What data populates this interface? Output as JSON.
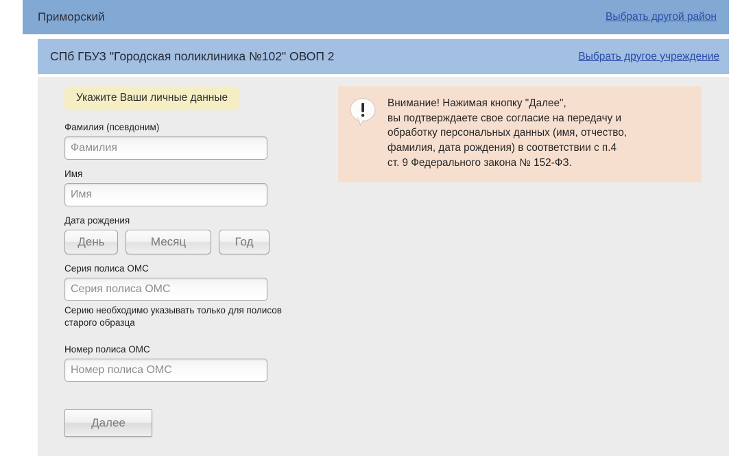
{
  "district_bar": {
    "district_name": "Приморский",
    "change_district_link": "Выбрать другой район"
  },
  "institution_bar": {
    "institution_name": "СПб ГБУЗ \"Городская поликлиника №102\" ОВОП 2",
    "change_institution_link": "Выбрать другое учреждение"
  },
  "form": {
    "section_badge": "Укажите Ваши личные данные",
    "fields": {
      "last_name": {
        "label": "Фамилия (псевдоним)",
        "placeholder": "Фамилия",
        "value": ""
      },
      "first_name": {
        "label": "Имя",
        "placeholder": "Имя",
        "value": ""
      },
      "birth_date": {
        "label": "Дата рождения",
        "day": "День",
        "month": "Месяц",
        "year": "Год"
      },
      "policy_series": {
        "label": "Серия полиса ОМС",
        "placeholder": "Серия полиса ОМС",
        "value": "",
        "hint": "Серию необходимо указывать только для полисов старого образца"
      },
      "policy_number": {
        "label": "Номер полиса ОМС",
        "placeholder": "Номер полиса ОМС",
        "value": ""
      }
    },
    "submit_label": "Далее"
  },
  "notice": {
    "icon": "exclamation-bubble-icon",
    "text": "Внимание! Нажимая кнопку \"Далее\",\nвы подтверждаете свое согласие на передачу и\nобработку персональных данных (имя, отчество,\nфамилия, дата рождения) в соответствии с п.4\nст. 9 Федерального закона № 152-ФЗ."
  },
  "colors": {
    "district_bar_bg": "#82a8d4",
    "institution_bar_bg": "#a3bfe2",
    "panel_bg": "#ececec",
    "badge_bg": "#f5eec4",
    "notice_bg": "#f7dfd0",
    "link": "#2b4da8"
  }
}
